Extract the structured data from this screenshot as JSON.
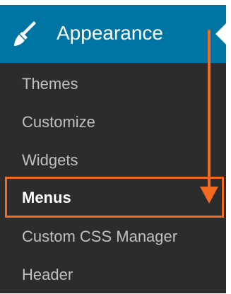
{
  "header": {
    "title": "Appearance",
    "icon": "paintbrush-icon",
    "background_color": "#0074a2"
  },
  "submenu": {
    "background_color": "#2c2c2c",
    "items": [
      {
        "label": "Themes"
      },
      {
        "label": "Customize"
      },
      {
        "label": "Widgets"
      },
      {
        "label": "Menus",
        "current": true
      },
      {
        "label": "Custom CSS Manager"
      },
      {
        "label": "Header"
      }
    ]
  },
  "annotation": {
    "color": "#f26b21",
    "target": "Menus"
  }
}
